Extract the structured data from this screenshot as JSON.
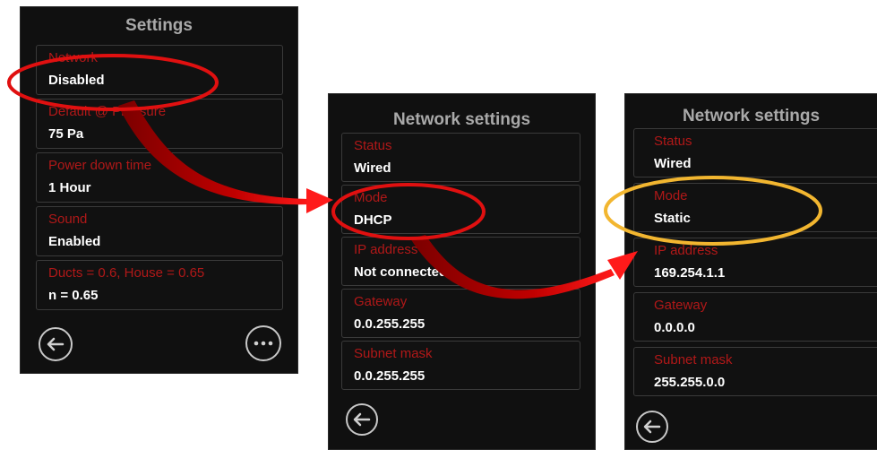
{
  "screens": {
    "settings": {
      "title": "Settings",
      "items": [
        {
          "label": "Network",
          "value": "Disabled"
        },
        {
          "label": "Default @ Pressure",
          "value": "75 Pa"
        },
        {
          "label": "Power down time",
          "value": "1 Hour"
        },
        {
          "label": "Sound",
          "value": "Enabled"
        },
        {
          "label": "Ducts = 0.6, House = 0.65",
          "value": "n = 0.65"
        }
      ],
      "back_icon": "back-arrow-icon",
      "more_icon": "more-dots-icon"
    },
    "network_dhcp": {
      "title": "Network settings",
      "items": [
        {
          "label": "Status",
          "value": "Wired"
        },
        {
          "label": "Mode",
          "value": "DHCP"
        },
        {
          "label": "IP address",
          "value": "Not connected"
        },
        {
          "label": "Gateway",
          "value": "0.0.255.255"
        },
        {
          "label": "Subnet mask",
          "value": "0.0.255.255"
        }
      ],
      "back_icon": "back-arrow-icon"
    },
    "network_static": {
      "title": "Network settings",
      "items": [
        {
          "label": "Status",
          "value": "Wired"
        },
        {
          "label": "Mode",
          "value": "Static"
        },
        {
          "label": "IP address",
          "value": "169.254.1.1"
        },
        {
          "label": "Gateway",
          "value": "0.0.0.0"
        },
        {
          "label": "Subnet mask",
          "value": "255.255.0.0"
        }
      ],
      "back_icon": "back-arrow-icon"
    }
  },
  "colors": {
    "screen_bg": "#101010",
    "label_red": "#b01818",
    "value_white": "#ffffff",
    "title_gray": "#a9a9a9",
    "highlight_red": "#e01010",
    "highlight_yellow": "#f2b630"
  }
}
